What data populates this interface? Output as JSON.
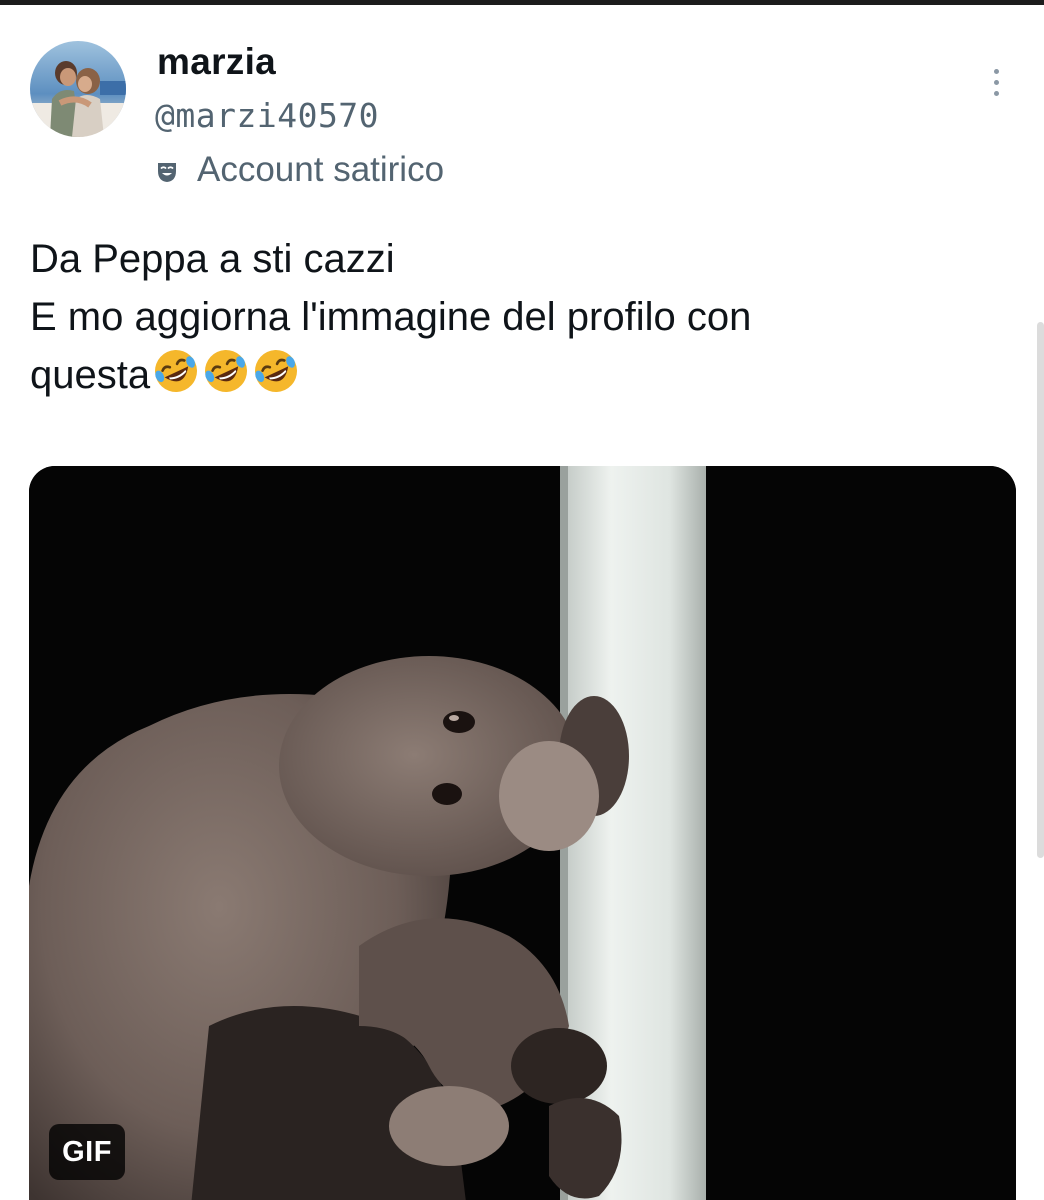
{
  "tweet": {
    "author": {
      "display_name": "marzia",
      "handle": "@marzi40570",
      "label": "Account satirico",
      "label_icon": "comedy-mask-icon",
      "avatar": "profile-photo"
    },
    "more_icon": "more-vertical-icon",
    "text_lines": [
      "Da Peppa a sti cazzi",
      "E mo aggiorna l'immagine del profilo con",
      "questa🤣🤣🤣"
    ],
    "media": {
      "kind": "animated-gif",
      "badge": "GIF"
    }
  },
  "colors": {
    "primary_text": "#0f1419",
    "secondary_text": "#536471",
    "media_background": "#050505"
  }
}
